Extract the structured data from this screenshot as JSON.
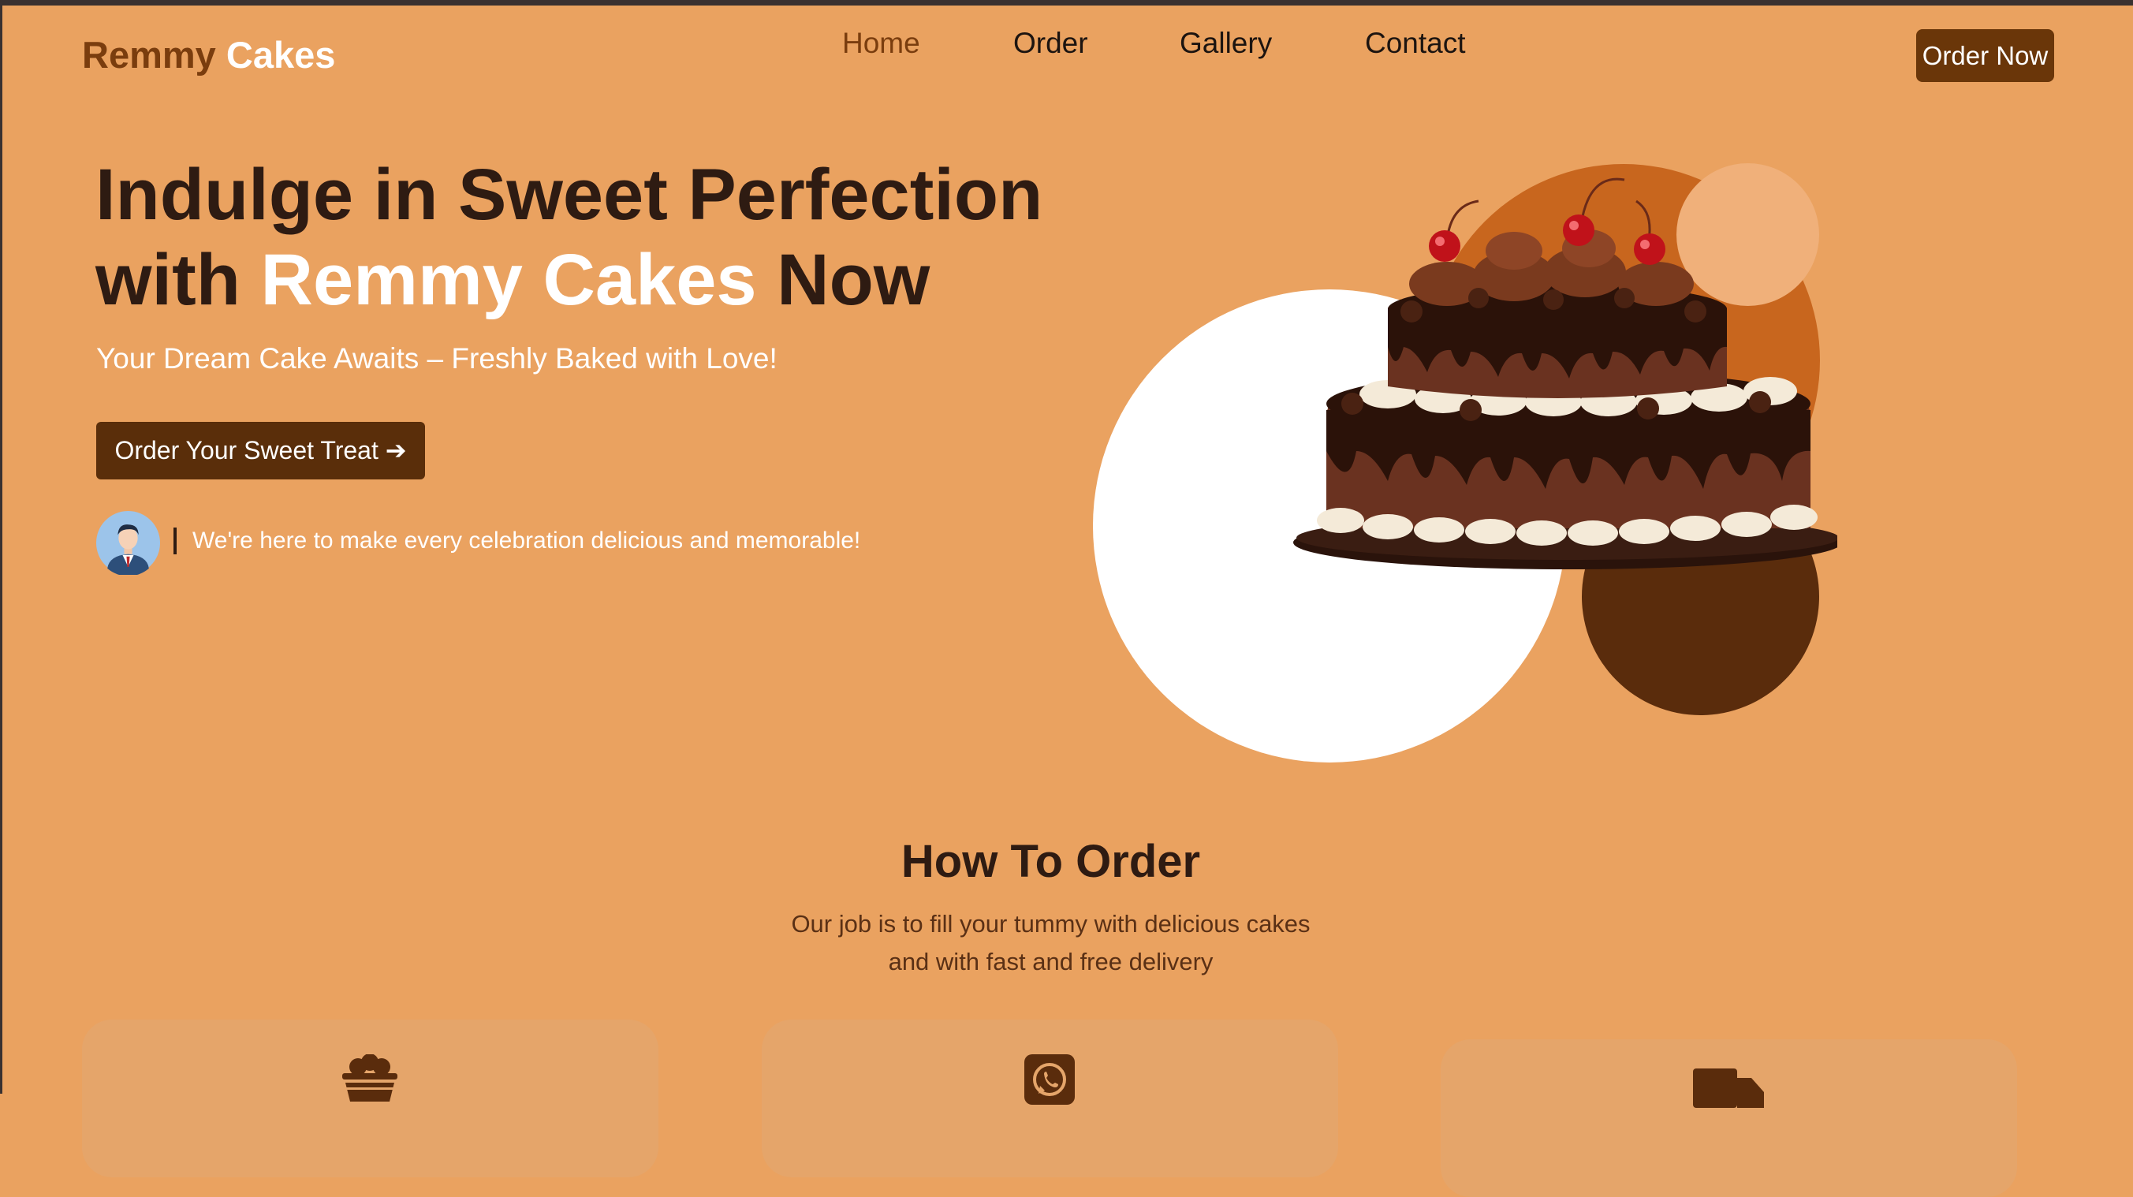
{
  "brand": {
    "name_part1": "Remmy",
    "name_part2": "Cakes"
  },
  "nav": {
    "items": [
      {
        "label": "Home",
        "active": true
      },
      {
        "label": "Order",
        "active": false
      },
      {
        "label": "Gallery",
        "active": false
      },
      {
        "label": "Contact",
        "active": false
      }
    ],
    "order_button": "Order Now"
  },
  "hero": {
    "title_line1": "Indulge in Sweet Perfection",
    "title_with": "with",
    "title_highlight": "Remmy Cakes",
    "title_end": "Now",
    "subtitle": "Your Dream Cake Awaits – Freshly Baked with Love!",
    "cta_label": "Order Your Sweet Treat ➔",
    "tagline": "We're here to make every celebration delicious and memorable!"
  },
  "how_to_order": {
    "title": "How To Order",
    "description_line1": "Our job is to fill your tummy with delicious cakes",
    "description_line2": "and with fast and free delivery",
    "cards": [
      {
        "icon": "basket-icon"
      },
      {
        "icon": "whatsapp-icon"
      },
      {
        "icon": "delivery-truck-icon"
      }
    ]
  },
  "colors": {
    "background": "#eaa260",
    "dark_brown": "#2e1b12",
    "accent_brown": "#7a3d0e",
    "button_brown": "#6a3609",
    "white": "#ffffff"
  }
}
